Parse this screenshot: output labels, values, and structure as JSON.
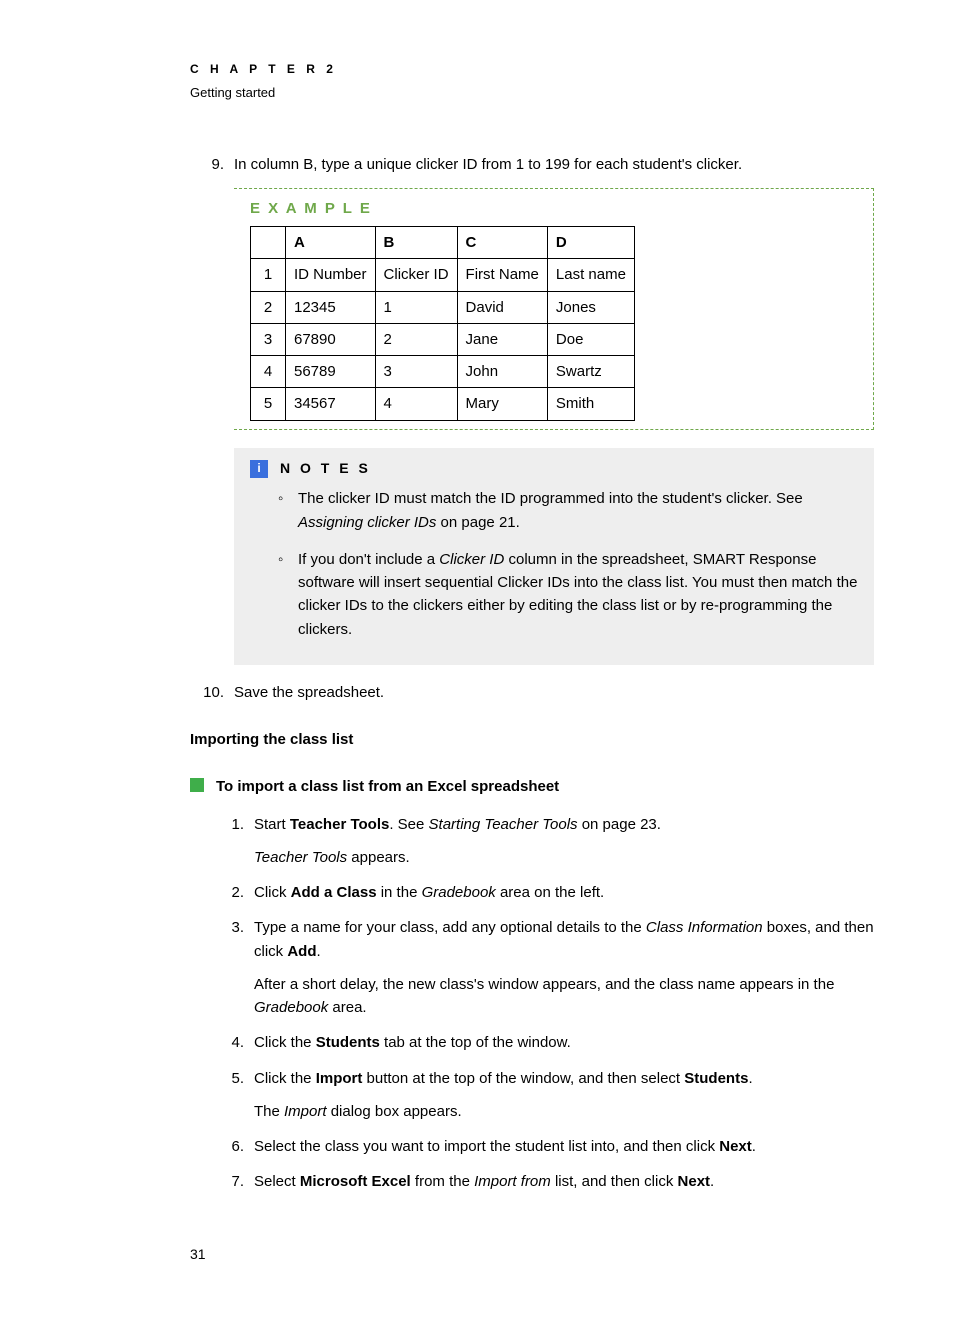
{
  "header": {
    "chapter": "C H A P T E R   2",
    "subtitle": "Getting started"
  },
  "step9": {
    "num": "9.",
    "text": "In column B, type a unique clicker ID from 1 to 199 for each student's clicker."
  },
  "example": {
    "title": "E X A M P L E",
    "cornerBlank": "",
    "cols": [
      "A",
      "B",
      "C",
      "D"
    ],
    "rows": [
      {
        "n": "1",
        "cells": [
          "ID Number",
          "Clicker ID",
          "First Name",
          "Last name"
        ]
      },
      {
        "n": "2",
        "cells": [
          "12345",
          "1",
          "David",
          "Jones"
        ]
      },
      {
        "n": "3",
        "cells": [
          "67890",
          "2",
          "Jane",
          "Doe"
        ]
      },
      {
        "n": "4",
        "cells": [
          "56789",
          "3",
          "John",
          "Swartz"
        ]
      },
      {
        "n": "5",
        "cells": [
          "34567",
          "4",
          "Mary",
          "Smith"
        ]
      }
    ]
  },
  "notes": {
    "icon": "i",
    "title": "N O T E S",
    "items": [
      {
        "pre": "The clicker ID must match the ID programmed into the student's clicker. See ",
        "em": "Assigning clicker IDs",
        "post": " on page 21."
      },
      {
        "pre": "If you don't include a ",
        "em": "Clicker ID",
        "post": " column in the spreadsheet, SMART Response software will insert sequential Clicker IDs into the class list. You must then match the clicker IDs to the clickers either by editing the class list or by re-programming the clickers."
      }
    ]
  },
  "step10": {
    "num": "10.",
    "text": "Save the spreadsheet."
  },
  "section": {
    "heading": "Importing the class list",
    "procTitle": "To import a class list from an Excel spreadsheet"
  },
  "proc": [
    {
      "num": "1.",
      "html": "Start <strong>Teacher Tools</strong>. See <em>Starting Teacher Tools</em> on page 23.",
      "sub": "<em>Teacher Tools</em> appears."
    },
    {
      "num": "2.",
      "html": "Click <strong>Add a Class</strong> in the <em>Gradebook</em> area on the left."
    },
    {
      "num": "3.",
      "html": "Type a name for your class, add any optional details to the <em>Class Information</em> boxes, and then click <strong>Add</strong>.",
      "sub": "After a short delay, the new class's window appears, and the class name appears in the <em>Gradebook</em> area."
    },
    {
      "num": "4.",
      "html": "Click the <strong>Students</strong> tab at the top of the window."
    },
    {
      "num": "5.",
      "html": "Click the <strong>Import</strong> button at the top of the window, and then select <strong>Students</strong>.",
      "sub": "The <em>Import</em> dialog box appears."
    },
    {
      "num": "6.",
      "html": "Select the class you want to import the student list into, and then click <strong>Next</strong>."
    },
    {
      "num": "7.",
      "html": "Select <strong>Microsoft Excel</strong> from the <em>Import from</em> list, and then click <strong>Next</strong>."
    }
  ],
  "pageNumber": "31"
}
